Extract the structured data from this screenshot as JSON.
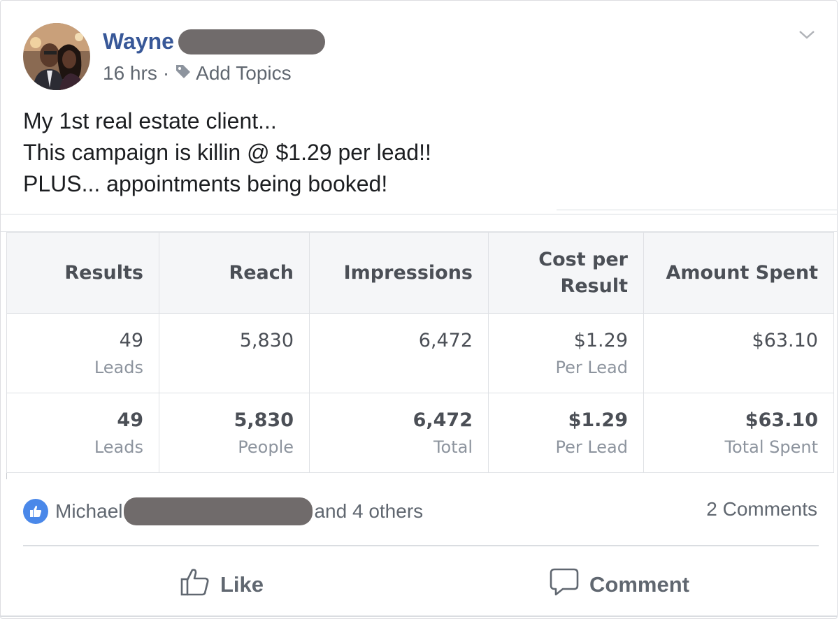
{
  "post": {
    "author_name": "Wayne",
    "time": "16 hrs",
    "meta_separator": "·",
    "add_topics": "Add Topics",
    "text_lines": [
      "My 1st real estate client...",
      "This campaign is killin @ $1.29 per lead!!",
      "PLUS... appointments being booked!"
    ]
  },
  "ad_table": {
    "headers": [
      "Results",
      "Reach",
      "Impressions",
      "Cost per Result",
      "Amount Spent"
    ],
    "header_cost_lines": [
      "Cost per",
      "Result"
    ],
    "rows": [
      {
        "results": {
          "value": "49",
          "sub": "Leads"
        },
        "reach": {
          "value": "5,830",
          "sub": ""
        },
        "impressions": {
          "value": "6,472",
          "sub": ""
        },
        "cost": {
          "value": "$1.29",
          "sub": "Per Lead"
        },
        "spent": {
          "value": "$63.10",
          "sub": ""
        }
      },
      {
        "results": {
          "value": "49",
          "sub": "Leads"
        },
        "reach": {
          "value": "5,830",
          "sub": "People"
        },
        "impressions": {
          "value": "6,472",
          "sub": "Total"
        },
        "cost": {
          "value": "$1.29",
          "sub": "Per Lead"
        },
        "spent": {
          "value": "$63.10",
          "sub": "Total Spent"
        }
      }
    ]
  },
  "reactions": {
    "name": "Michael",
    "others": "and 4 others",
    "comments": "2 Comments"
  },
  "actions": {
    "like": "Like",
    "comment": "Comment"
  },
  "icons": {
    "chevron": "chevron-down-icon",
    "tag": "tag-icon",
    "like_badge": "thumbs-up-icon",
    "like_action": "thumbs-up-outline-icon",
    "comment_action": "speech-bubble-icon"
  },
  "colors": {
    "author": "#385898",
    "like_badge": "#4a88e9",
    "redaction": "#706b6b"
  }
}
